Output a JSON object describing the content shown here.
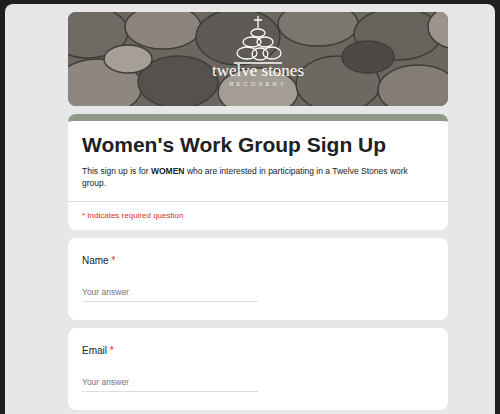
{
  "banner": {
    "logo_title": "twelve stones",
    "logo_subtitle": "RECOVERY"
  },
  "form": {
    "title": "Women's Work Group Sign Up",
    "description": [
      {
        "text": "This sign up is for ",
        "bold": false
      },
      {
        "text": "WOMEN",
        "bold": true
      },
      {
        "text": " who are interested in participating in a Twelve Stones work group.",
        "bold": false
      }
    ],
    "required_note": "* Indicates required question"
  },
  "questions": [
    {
      "label": "Name",
      "required": true,
      "required_mark": "*",
      "placeholder": "Your answer"
    },
    {
      "label": "Email",
      "required": true,
      "required_mark": "*",
      "placeholder": "Your answer"
    }
  ]
}
